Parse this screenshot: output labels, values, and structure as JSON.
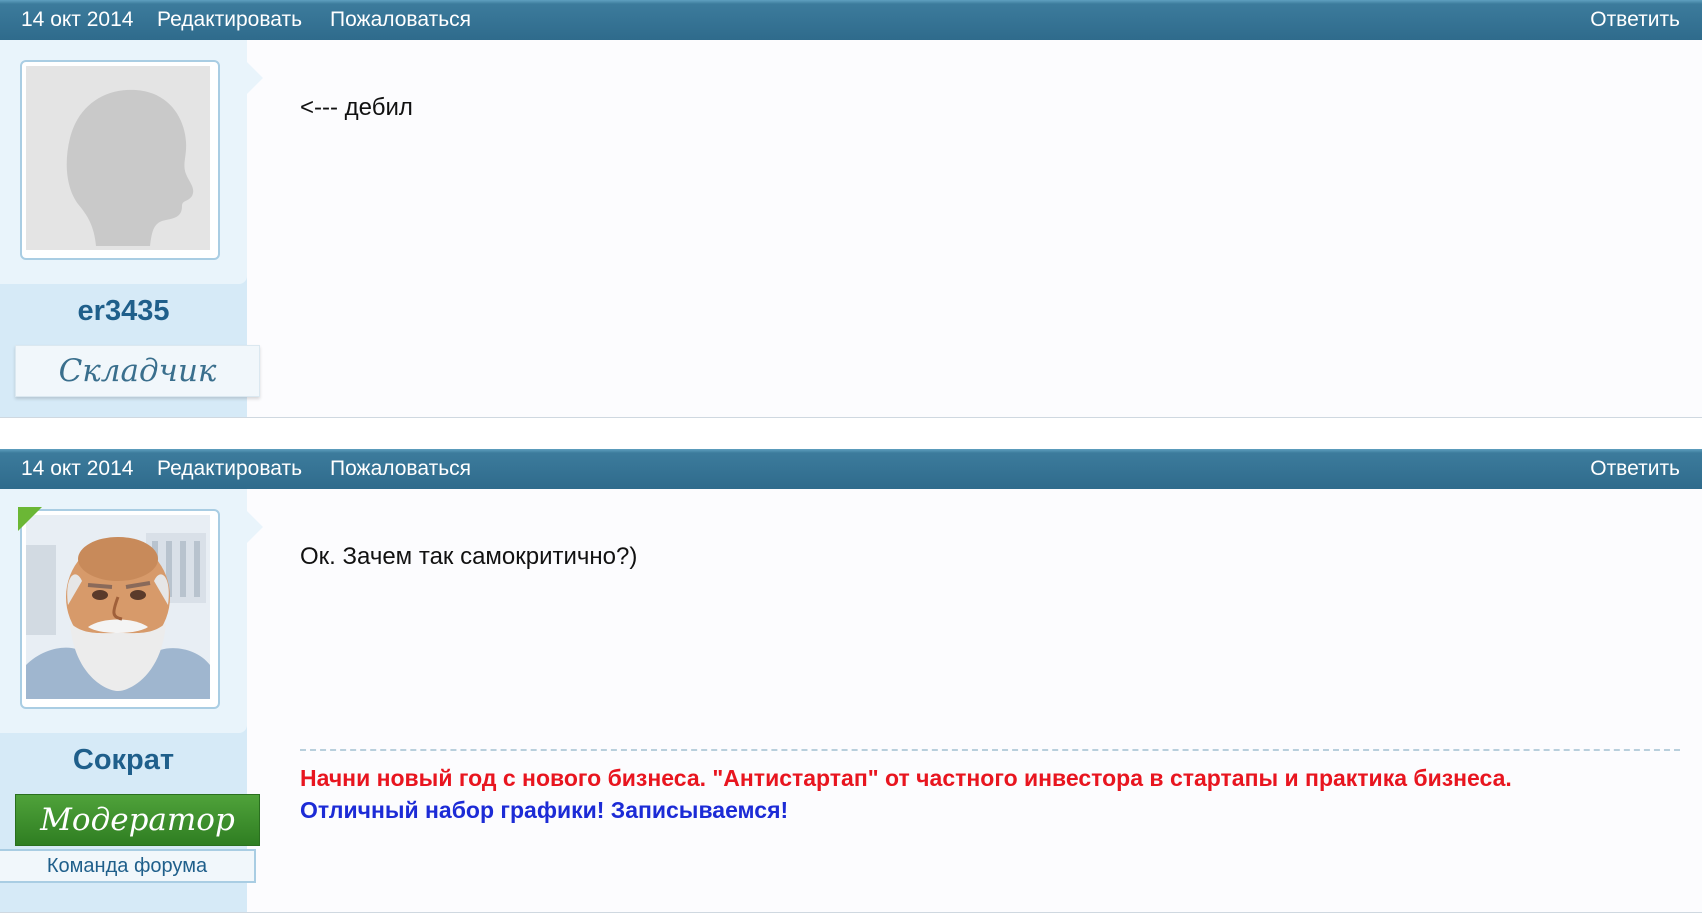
{
  "posts": [
    {
      "date": "14 окт 2014",
      "edit_label": "Редактировать",
      "report_label": "Пожаловаться",
      "reply_label": "Ответить",
      "username": "er3435",
      "rank": "Складчик",
      "message": "<--- дебил"
    },
    {
      "date": "14 окт 2014",
      "edit_label": "Редактировать",
      "report_label": "Пожаловаться",
      "reply_label": "Ответить",
      "username": "Сократ",
      "rank": "Модератор",
      "team_label": "Команда форума",
      "message": "Ок. Зачем так самокритично?)",
      "signature": {
        "line1": "Начни новый год с нового бизнеса. \"Антистартап\" от частного инвестора в стартапы и практика бизнеса.",
        "line2": "Отличный набор графики! Записываемся!",
        "line1_color": "#e8151f",
        "line2_color": "#1c2bd6"
      }
    }
  ],
  "colors": {
    "header": "#2f6b8c",
    "sidebar": "#d6eaf7",
    "username": "#1f5f8b",
    "moderator_green": "#2f7e22",
    "online_badge": "#6bb735"
  },
  "icons": {
    "default_avatar": "silhouette-avatar-icon",
    "custom_avatar": "socrates-avatar-icon"
  }
}
